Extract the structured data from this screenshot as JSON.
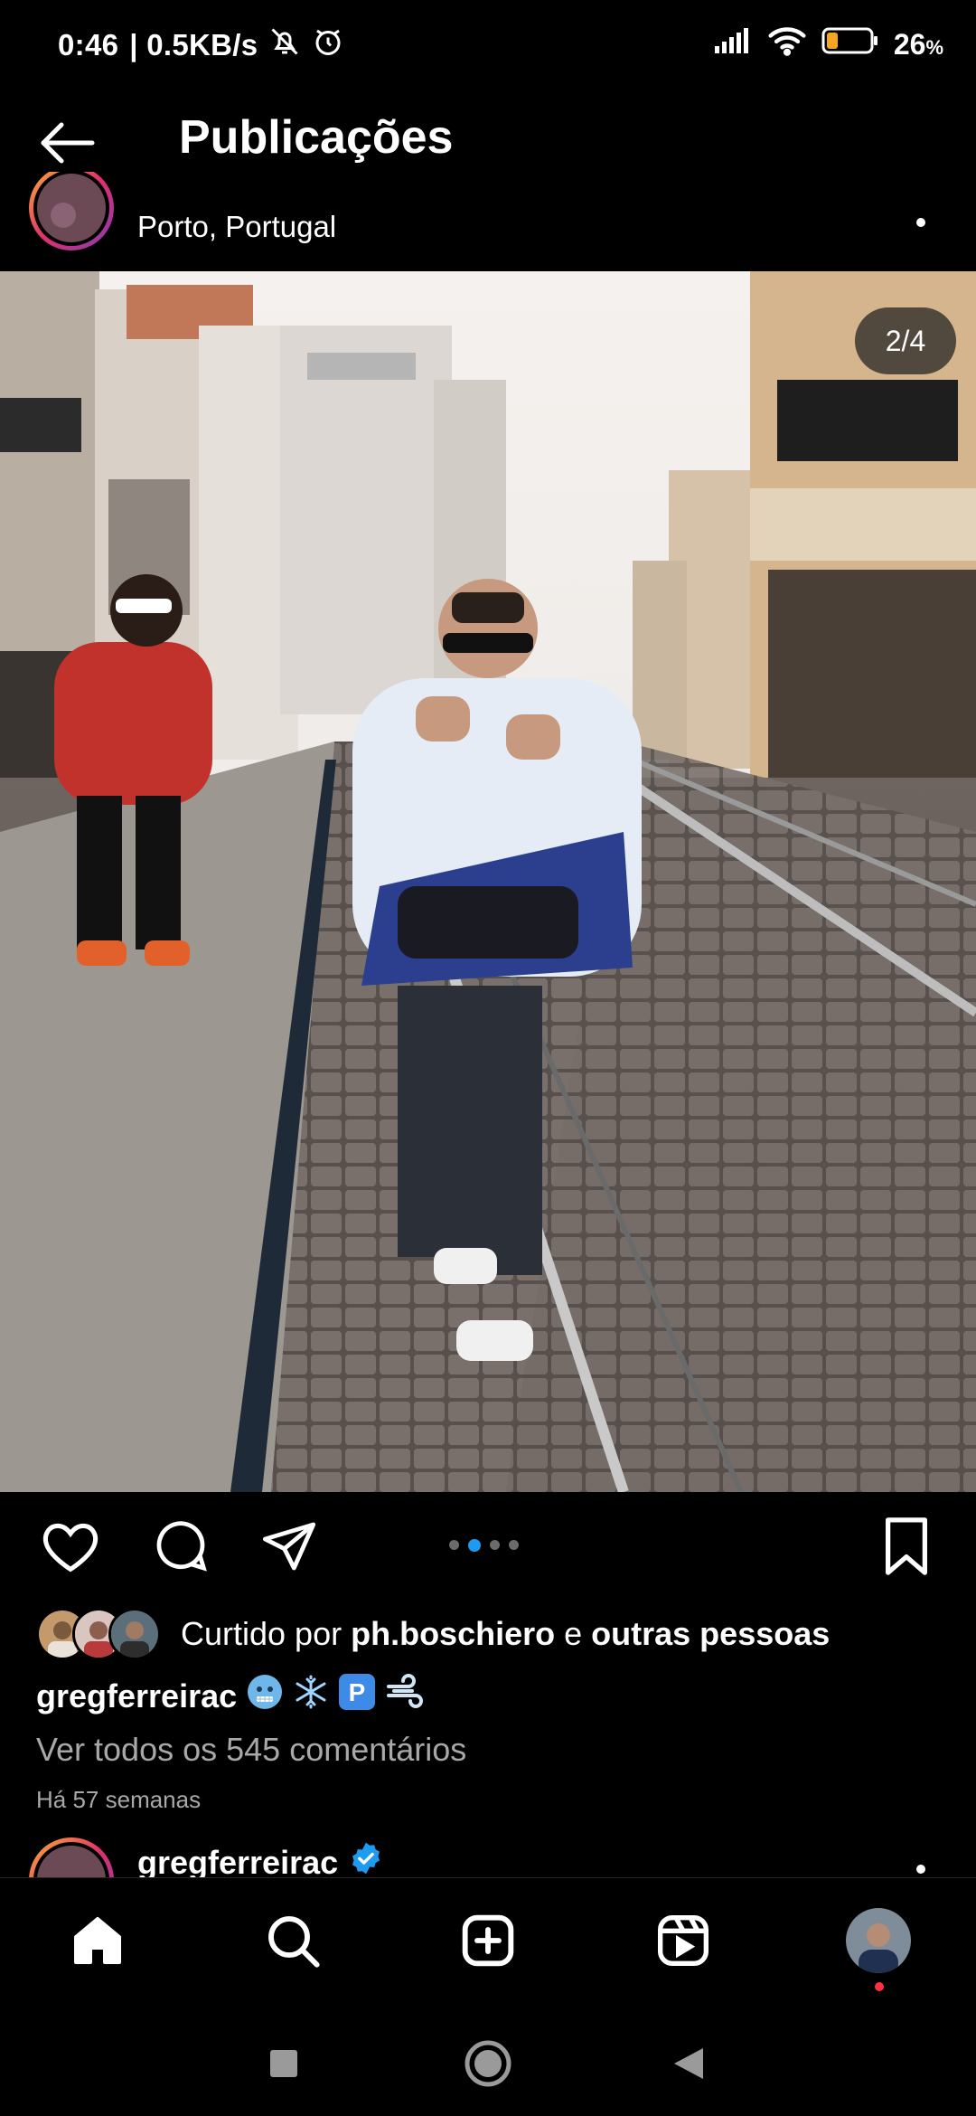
{
  "status_bar": {
    "time": "0:46",
    "net_speed": "| 0.5KB/s",
    "battery_percent": "26",
    "battery_unit": "%",
    "battery_level": 0.26
  },
  "header": {
    "title": "Publicações"
  },
  "post": {
    "location": "Porto, Portugal",
    "counter": "2/4",
    "carousel_total": 4,
    "carousel_active": 2,
    "liked_prefix": "Curtido por ",
    "liked_user": "ph.boschiero",
    "liked_joiner": " e ",
    "liked_others": "outras pessoas",
    "caption_user": "gregferreirac",
    "caption_emojis": [
      "cold-face-emoji",
      "snowflake-emoji",
      "p-button-emoji",
      "dash-emoji"
    ],
    "comments_link": "Ver todos os 545 comentários",
    "age": "Há 57 semanas"
  },
  "next_post": {
    "username": "gregferreirac"
  },
  "colors": {
    "accent": "#1d9bf0",
    "secondary_text": "#a8a8a8",
    "notification": "#ff3040"
  }
}
